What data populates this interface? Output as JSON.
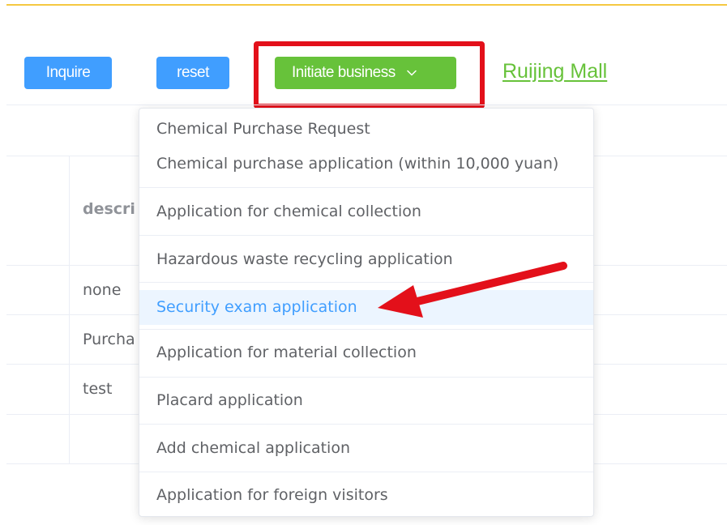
{
  "toolbar": {
    "inquire_label": "Inquire",
    "reset_label": "reset",
    "initiate_label": "Initiate business",
    "mall_link_label": "Ruijing Mall"
  },
  "table": {
    "header": "describ",
    "rows": [
      "none",
      "Purcha",
      "test"
    ]
  },
  "dropdown": {
    "items": [
      "Chemical Purchase Request",
      "Chemical purchase application (within 10,000 yuan)",
      "Application for chemical collection",
      "Hazardous waste recycling application",
      "Security exam application",
      "Application for material collection",
      "Placard application",
      "Add chemical application",
      "Application for foreign visitors"
    ],
    "active_item": "Security exam application"
  },
  "colors": {
    "primary_blue": "#409eff",
    "success_green": "#67c23a",
    "annotation_red": "#e3101a",
    "accent_yellow": "#f5c842",
    "hover_bg": "#ecf5ff"
  },
  "icons": {
    "initiate_chevron": "chevron-down-icon",
    "annotation_arrow": "red-arrow-annotation"
  }
}
